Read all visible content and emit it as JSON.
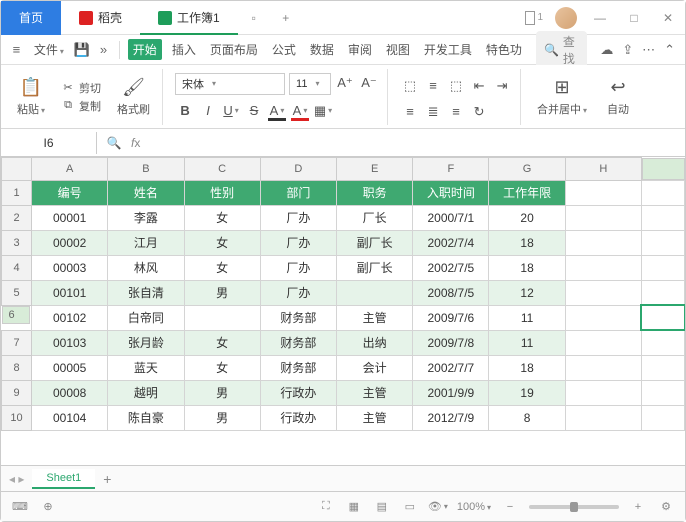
{
  "titlebar": {
    "home": "首页",
    "docer": "稻壳",
    "workbook": "工作簿1"
  },
  "menu": {
    "file": "文件",
    "tabs": [
      "开始",
      "插入",
      "页面布局",
      "公式",
      "数据",
      "审阅",
      "视图",
      "开发工具",
      "特色功"
    ],
    "search": "查找"
  },
  "ribbon": {
    "paste": "粘贴",
    "cut": "剪切",
    "copy": "复制",
    "format_painter": "格式刷",
    "font": "宋体",
    "size": "11",
    "merge": "合并居中",
    "autowrap": "自动"
  },
  "cellref": "I6",
  "columns": [
    "A",
    "B",
    "C",
    "D",
    "E",
    "F",
    "G",
    "H",
    ""
  ],
  "header_row": [
    "编号",
    "姓名",
    "性别",
    "部门",
    "职务",
    "入职时间",
    "工作年限"
  ],
  "rows": [
    {
      "n": 2,
      "alt": false,
      "c": [
        "00001",
        "李露",
        "女",
        "厂办",
        "厂长",
        "2000/7/1",
        "20"
      ]
    },
    {
      "n": 3,
      "alt": true,
      "c": [
        "00002",
        "江月",
        "女",
        "厂办",
        "副厂长",
        "2002/7/4",
        "18"
      ]
    },
    {
      "n": 4,
      "alt": false,
      "c": [
        "00003",
        "林风",
        "女",
        "厂办",
        "副厂长",
        "2002/7/5",
        "18"
      ]
    },
    {
      "n": 5,
      "alt": true,
      "c": [
        "00101",
        "张自清",
        "男",
        "厂办",
        "",
        "2008/7/5",
        "12"
      ]
    },
    {
      "n": 6,
      "alt": false,
      "c": [
        "00102",
        "白帝同",
        "",
        "财务部",
        "主管",
        "2009/7/6",
        "11"
      ]
    },
    {
      "n": 7,
      "alt": true,
      "c": [
        "00103",
        "张月龄",
        "女",
        "财务部",
        "出纳",
        "2009/7/8",
        "11"
      ]
    },
    {
      "n": 8,
      "alt": false,
      "c": [
        "00005",
        "蓝天",
        "女",
        "财务部",
        "会计",
        "2002/7/7",
        "18"
      ]
    },
    {
      "n": 9,
      "alt": true,
      "c": [
        "00008",
        "越明",
        "男",
        "行政办",
        "主管",
        "2001/9/9",
        "19"
      ]
    },
    {
      "n": 10,
      "alt": false,
      "c": [
        "00104",
        "陈自豪",
        "男",
        "行政办",
        "主管",
        "2012/7/9",
        "8"
      ]
    }
  ],
  "sheet": "Sheet1",
  "zoom": "100%"
}
